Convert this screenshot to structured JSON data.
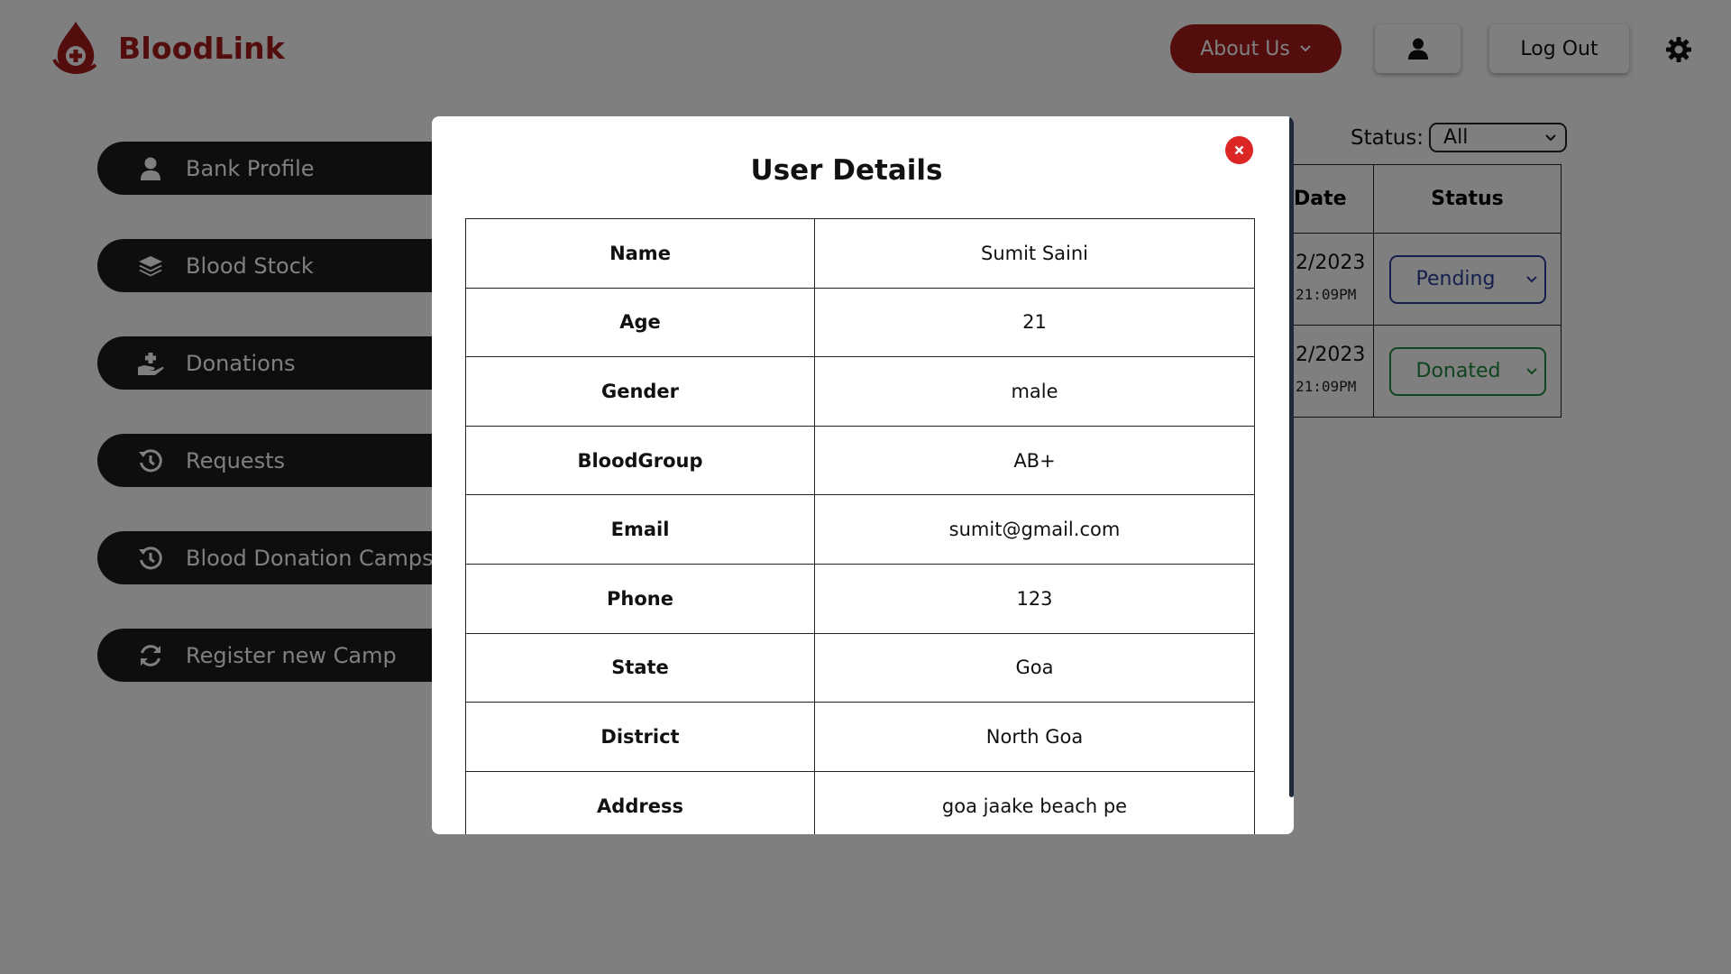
{
  "header": {
    "brand": "BloodLink",
    "about_label": "About Us",
    "logout_label": "Log Out"
  },
  "sidebar": {
    "items": [
      {
        "label": "Bank Profile",
        "icon": "user-icon"
      },
      {
        "label": "Blood Stock",
        "icon": "layers-icon"
      },
      {
        "label": "Donations",
        "icon": "hand-donate-icon"
      },
      {
        "label": "Requests",
        "icon": "history-icon"
      },
      {
        "label": "Blood Donation Camps",
        "icon": "history-icon"
      },
      {
        "label": "Register new Camp",
        "icon": "refresh-icon"
      }
    ]
  },
  "filter": {
    "label": "Status:",
    "value": "All"
  },
  "table": {
    "headers": {
      "date": "Date",
      "status": "Status"
    },
    "rows": [
      {
        "date": "2/2023",
        "time": "21:09PM",
        "status": "Pending"
      },
      {
        "date": "2/2023",
        "time": "21:09PM",
        "status": "Donated"
      }
    ]
  },
  "modal": {
    "title": "User Details",
    "rows": [
      {
        "key": "Name",
        "value": "Sumit Saini"
      },
      {
        "key": "Age",
        "value": "21"
      },
      {
        "key": "Gender",
        "value": "male"
      },
      {
        "key": "BloodGroup",
        "value": "AB+"
      },
      {
        "key": "Email",
        "value": "sumit@gmail.com"
      },
      {
        "key": "Phone",
        "value": "123"
      },
      {
        "key": "State",
        "value": "Goa"
      },
      {
        "key": "District",
        "value": "North Goa"
      },
      {
        "key": "Address",
        "value": "goa jaake beach pe"
      }
    ]
  },
  "colors": {
    "brand": "#a81b1b",
    "pending": "#2b3f9c",
    "donated": "#1e8a3c",
    "close": "#dc2626"
  }
}
